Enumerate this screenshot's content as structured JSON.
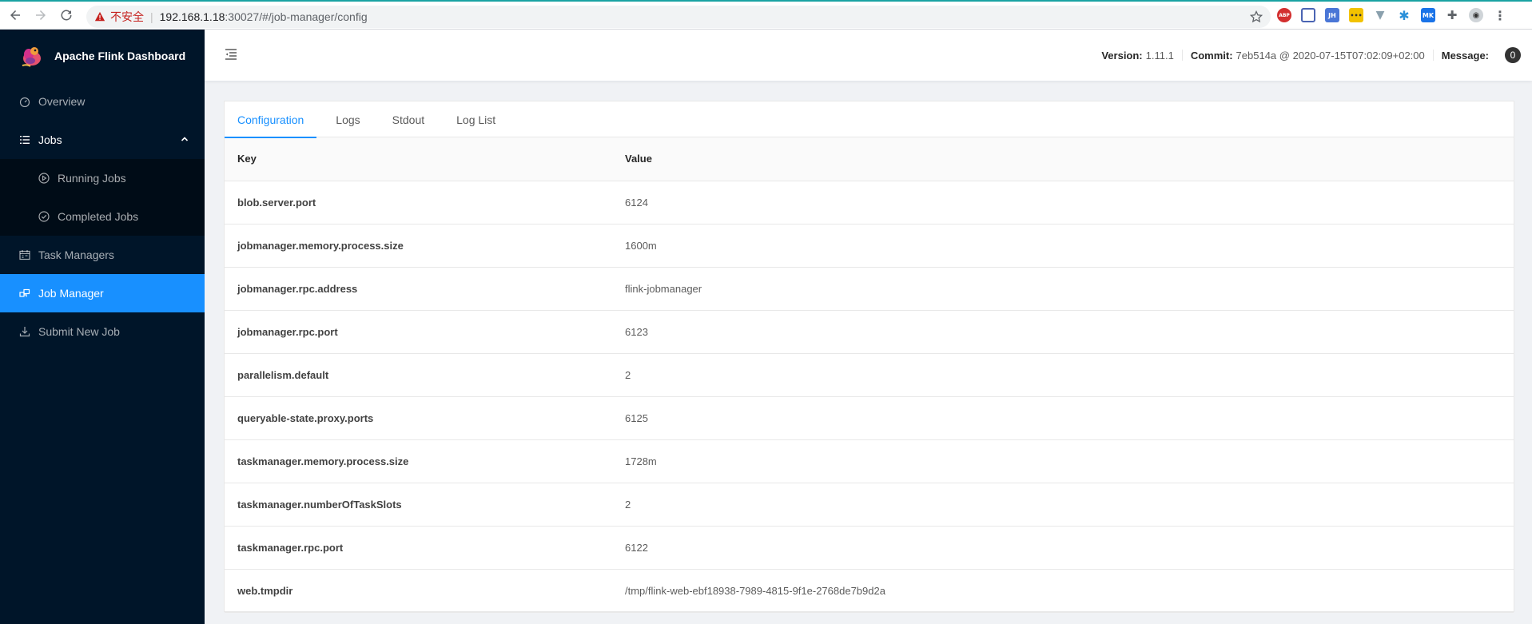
{
  "browser": {
    "insecure_label": "不安全",
    "url_host": "192.168.1.18",
    "url_path": ":30027/#/job-manager/config"
  },
  "app": {
    "title": "Apache Flink Dashboard"
  },
  "sidebar": {
    "items": [
      {
        "label": "Overview",
        "icon": "dashboard-icon"
      },
      {
        "label": "Jobs",
        "icon": "list-icon"
      },
      {
        "label": "Running Jobs",
        "icon": "play-circle-icon"
      },
      {
        "label": "Completed Jobs",
        "icon": "check-circle-icon"
      },
      {
        "label": "Task Managers",
        "icon": "schedule-icon"
      },
      {
        "label": "Job Manager",
        "icon": "cluster-icon"
      },
      {
        "label": "Submit New Job",
        "icon": "upload-icon"
      }
    ]
  },
  "header": {
    "version_label": "Version:",
    "version_value": "1.11.1",
    "commit_label": "Commit:",
    "commit_value": "7eb514a @ 2020-07-15T07:02:09+02:00",
    "message_label": "Message:",
    "message_count": "0"
  },
  "tabs": [
    {
      "label": "Configuration"
    },
    {
      "label": "Logs"
    },
    {
      "label": "Stdout"
    },
    {
      "label": "Log List"
    }
  ],
  "table": {
    "headers": {
      "key": "Key",
      "value": "Value"
    },
    "rows": [
      {
        "key": "blob.server.port",
        "value": "6124"
      },
      {
        "key": "jobmanager.memory.process.size",
        "value": "1600m"
      },
      {
        "key": "jobmanager.rpc.address",
        "value": "flink-jobmanager"
      },
      {
        "key": "jobmanager.rpc.port",
        "value": "6123"
      },
      {
        "key": "parallelism.default",
        "value": "2"
      },
      {
        "key": "queryable-state.proxy.ports",
        "value": "6125"
      },
      {
        "key": "taskmanager.memory.process.size",
        "value": "1728m"
      },
      {
        "key": "taskmanager.numberOfTaskSlots",
        "value": "2"
      },
      {
        "key": "taskmanager.rpc.port",
        "value": "6122"
      },
      {
        "key": "web.tmpdir",
        "value": "/tmp/flink-web-ebf18938-7989-4815-9f1e-2768de7b9d2a"
      }
    ]
  },
  "colors": {
    "sidebar_bg": "#001529",
    "accent": "#1890ff"
  }
}
